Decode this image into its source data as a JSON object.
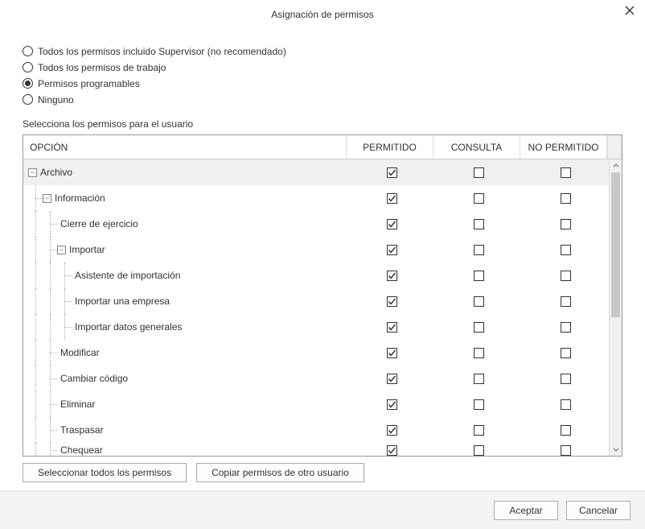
{
  "title": "Asignación de permisos",
  "radios": [
    {
      "label": "Todos los permisos incluido Supervisor (no recomendado)",
      "checked": false
    },
    {
      "label": "Todos los permisos de trabajo",
      "checked": false
    },
    {
      "label": "Permisos programables",
      "checked": true
    },
    {
      "label": "Ninguno",
      "checked": false
    }
  ],
  "section_label": "Selecciona los permisos para el usuario",
  "headers": {
    "option": "OPCIÓN",
    "allowed": "PERMITIDO",
    "query": "CONSULTA",
    "denied": "NO PERMITIDO"
  },
  "rows": [
    {
      "label": "Archivo",
      "level": 0,
      "group": true,
      "expander": "−",
      "allowed": true,
      "query": false,
      "denied": false
    },
    {
      "label": "Información",
      "level": 1,
      "group": false,
      "expander": "−",
      "allowed": true,
      "query": false,
      "denied": false
    },
    {
      "label": "Cierre de ejercicio",
      "level": 2,
      "group": false,
      "expander": null,
      "allowed": true,
      "query": false,
      "denied": false
    },
    {
      "label": "Importar",
      "level": 2,
      "group": false,
      "expander": "−",
      "allowed": true,
      "query": false,
      "denied": false
    },
    {
      "label": "Asistente de importación",
      "level": 3,
      "group": false,
      "expander": null,
      "allowed": true,
      "query": false,
      "denied": false
    },
    {
      "label": "Importar una empresa",
      "level": 3,
      "group": false,
      "expander": null,
      "allowed": true,
      "query": false,
      "denied": false
    },
    {
      "label": "Importar datos generales",
      "level": 3,
      "group": false,
      "expander": null,
      "allowed": true,
      "query": false,
      "denied": false
    },
    {
      "label": "Modificar",
      "level": 2,
      "group": false,
      "expander": null,
      "allowed": true,
      "query": false,
      "denied": false
    },
    {
      "label": "Cambiar código",
      "level": 2,
      "group": false,
      "expander": null,
      "allowed": true,
      "query": false,
      "denied": false
    },
    {
      "label": "Eliminar",
      "level": 2,
      "group": false,
      "expander": null,
      "allowed": true,
      "query": false,
      "denied": false
    },
    {
      "label": "Traspasar",
      "level": 2,
      "group": false,
      "expander": null,
      "allowed": true,
      "query": false,
      "denied": false
    },
    {
      "label": "Chequear",
      "level": 2,
      "group": false,
      "expander": null,
      "allowed": true,
      "query": false,
      "denied": false,
      "cut": true
    }
  ],
  "buttons": {
    "select_all": "Seleccionar todos los permisos",
    "copy_perms": "Copiar permisos de otro usuario",
    "ok": "Aceptar",
    "cancel": "Cancelar"
  }
}
